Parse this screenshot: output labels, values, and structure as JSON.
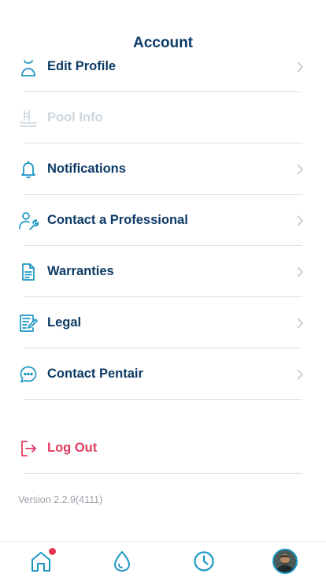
{
  "header": {
    "title": "Account"
  },
  "menu": {
    "items": [
      {
        "label": "Edit Profile",
        "icon": "profile-icon",
        "disabled": false
      },
      {
        "label": "Pool Info",
        "icon": "pool-ladder-icon",
        "disabled": true
      },
      {
        "label": "Notifications",
        "icon": "bell-icon",
        "disabled": false
      },
      {
        "label": "Contact a Professional",
        "icon": "technician-icon",
        "disabled": false
      },
      {
        "label": "Warranties",
        "icon": "document-icon",
        "disabled": false
      },
      {
        "label": "Legal",
        "icon": "legal-doc-icon",
        "disabled": false
      },
      {
        "label": "Contact Pentair",
        "icon": "chat-bubble-icon",
        "disabled": false
      }
    ]
  },
  "logout": {
    "label": "Log Out",
    "icon": "logout-icon"
  },
  "footer": {
    "version": "Version 2.2.9(4111)"
  },
  "tabbar": {
    "tabs": [
      {
        "name": "home",
        "icon": "home-icon",
        "has_badge": true
      },
      {
        "name": "water",
        "icon": "water-drop-icon",
        "has_badge": false
      },
      {
        "name": "history",
        "icon": "clock-icon",
        "has_badge": false
      },
      {
        "name": "account",
        "icon": "avatar",
        "has_badge": false
      }
    ]
  },
  "colors": {
    "primary_text": "#0d3a66",
    "accent": "#1c96c2",
    "disabled": "#cfd6dc",
    "logout": "#e23b63",
    "badge": "#e8344f",
    "divider": "#dcdfe3"
  }
}
